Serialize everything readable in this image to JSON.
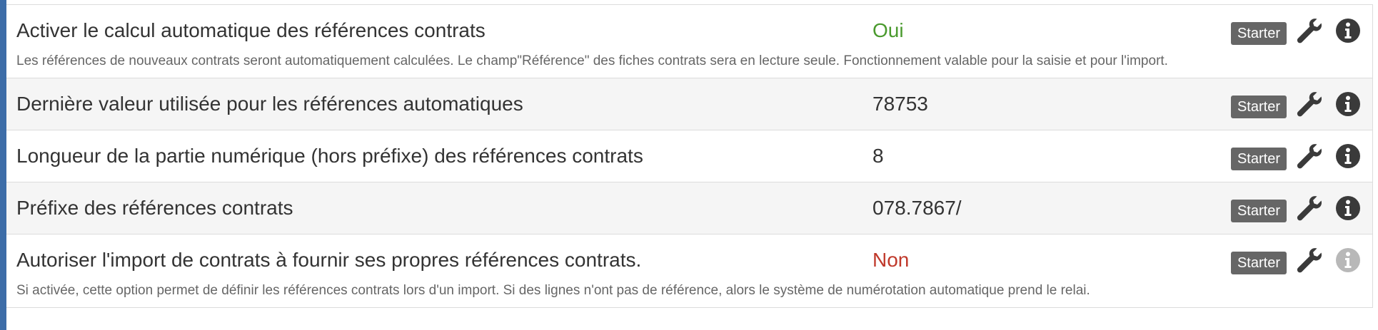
{
  "settings": {
    "rows": [
      {
        "label": "Activer le calcul automatique des références contrats",
        "value": "Oui",
        "badge": "Starter",
        "description": "Les références de nouveaux contrats seront automatiquement calculées. Le champ\"Référence\" des fiches contrats sera en lecture seule. Fonctionnement valable pour la saisie et pour l'import."
      },
      {
        "label": "Dernière valeur utilisée pour les références automatiques",
        "value": "78753",
        "badge": "Starter"
      },
      {
        "label": "Longueur de la partie numérique (hors préfixe) des références contrats",
        "value": "8",
        "badge": "Starter"
      },
      {
        "label": "Préfixe des références contrats",
        "value": "078.7867/",
        "badge": "Starter"
      },
      {
        "label": "Autoriser l'import de contrats à fournir ses propres références contrats.",
        "value": "Non",
        "badge": "Starter",
        "description": "Si activée, cette option permet de définir les références contrats lors d'un import. Si des lignes n'ont pas de référence, alors le système de numérotation automatique prend le relai."
      }
    ]
  },
  "icons": {
    "wrench": "wrench-icon",
    "info": "info-icon"
  },
  "colors": {
    "accent_bar": "#3d6da8",
    "yes": "#4a9a2e",
    "no": "#c0392b",
    "badge_bg": "#666666",
    "icon_dark": "#3a3a3a",
    "icon_muted": "#b8b8b8"
  }
}
